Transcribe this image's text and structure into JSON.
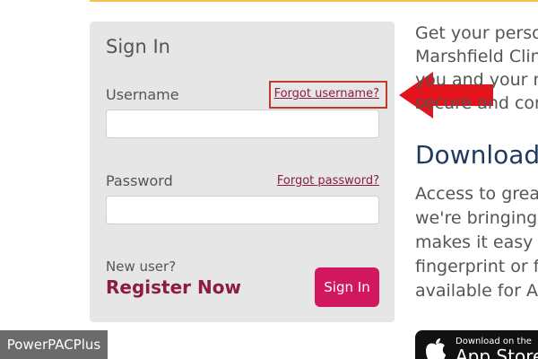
{
  "signin": {
    "title": "Sign In",
    "username_label": "Username",
    "forgot_username": "Forgot username?",
    "password_label": "Password",
    "forgot_password": "Forgot password?",
    "username_value": "",
    "password_value": "",
    "new_user": "New user?",
    "register_now": "Register Now",
    "signin_button": "Sign In"
  },
  "info": {
    "intro": "Get your perso\nMarshfield Clin\nyou and your n\nsecure and con",
    "download_heading": "Download",
    "access": "Access to great\nwe're bringing\nmakes it easy t\nfingerprint or f\navailable for Ar"
  },
  "app_store_badge": {
    "small": "Download on the",
    "big": "App Store"
  },
  "watermark": "PowerPACPlus",
  "colors": {
    "brand": "#8c1d40",
    "button": "#d1175e",
    "arrow": "#e3141b",
    "highlight_box": "#c0392b",
    "heading": "#1e3a5f"
  }
}
